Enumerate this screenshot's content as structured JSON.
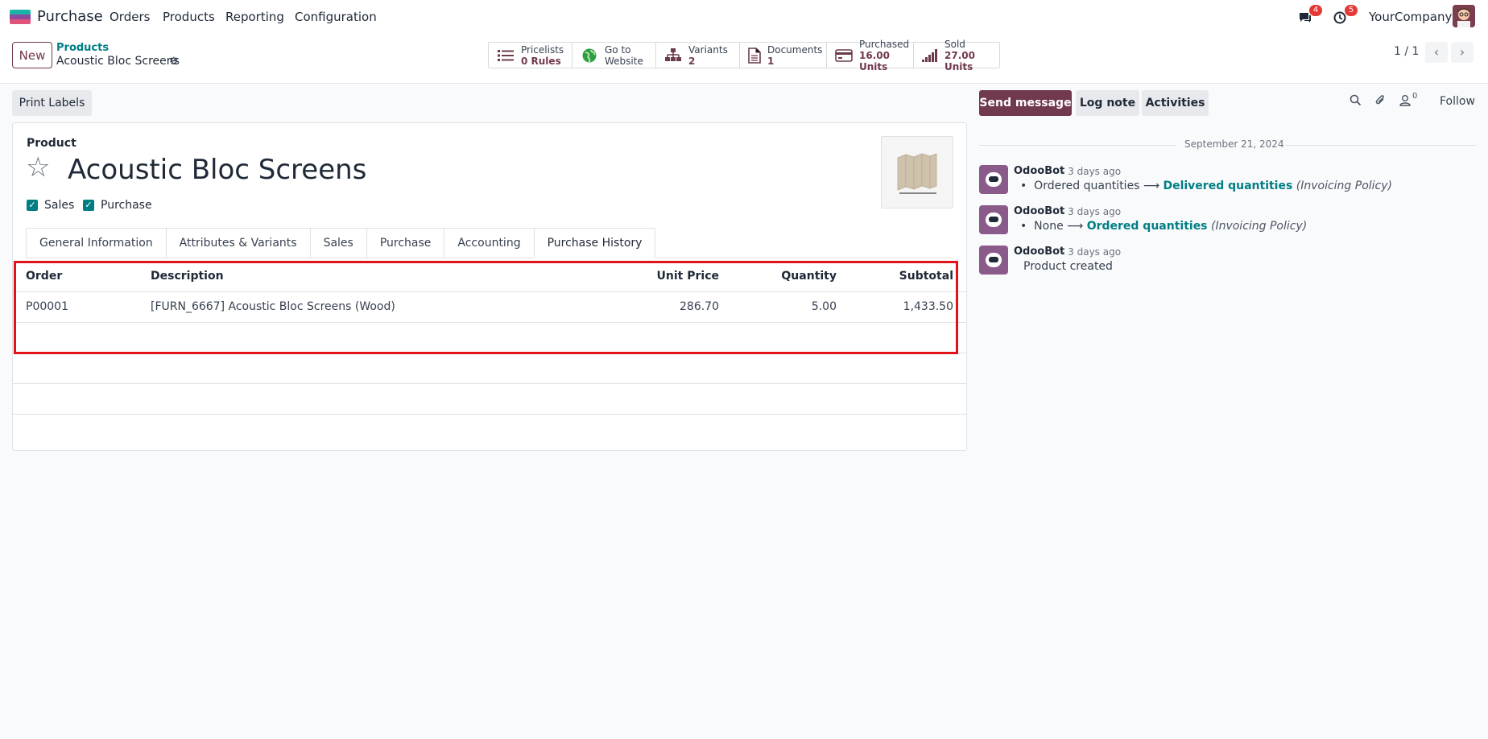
{
  "topbar": {
    "app_name": "Purchase",
    "menu": [
      "Orders",
      "Products",
      "Reporting",
      "Configuration"
    ],
    "chat_count": "4",
    "activity_count": "5",
    "company": "YourCompany"
  },
  "control": {
    "new_label": "New",
    "breadcrumb_parent": "Products",
    "breadcrumb_current": "Acoustic Bloc Screens",
    "smart_buttons": [
      {
        "l1": "Pricelists",
        "l2": "0 Rules",
        "icon": "list-icon"
      },
      {
        "l1": "Go to",
        "l2": "Website",
        "icon": "globe-icon"
      },
      {
        "l1": "Variants",
        "l2": "2",
        "icon": "sitemap-icon"
      },
      {
        "l1": "Documents",
        "l2": "1",
        "icon": "file-icon"
      },
      {
        "l1": "Purchased",
        "l2": "16.00 Units",
        "icon": "credit-card-icon"
      },
      {
        "l1": "Sold",
        "l2": "27.00 Units",
        "icon": "signal-icon"
      }
    ],
    "pager": "1 / 1"
  },
  "form": {
    "print_labels": "Print Labels",
    "product_label": "Product",
    "product_name": "Acoustic Bloc Screens",
    "sales_label": "Sales",
    "purchase_label": "Purchase",
    "tabs": [
      "General Information",
      "Attributes & Variants",
      "Sales",
      "Purchase",
      "Accounting",
      "Purchase History"
    ],
    "table": {
      "headers": [
        "Order",
        "Description",
        "Unit Price",
        "Quantity",
        "Subtotal"
      ],
      "rows": [
        [
          "P00001",
          "[FURN_6667] Acoustic Bloc Screens (Wood)",
          "286.70",
          "5.00",
          "1,433.50"
        ]
      ]
    }
  },
  "chatter": {
    "send_message": "Send message",
    "log_note": "Log note",
    "activities": "Activities",
    "followers_count": "0",
    "follow": "Follow",
    "date": "September 21, 2024",
    "messages": [
      {
        "author": "OdooBot",
        "when": "- 3 days ago",
        "old": "Ordered quantities",
        "new": "Delivered quantities",
        "field": "(Invoicing Policy)"
      },
      {
        "author": "OdooBot",
        "when": "- 3 days ago",
        "old": "None",
        "new": "Ordered quantities",
        "field": "(Invoicing Policy)"
      },
      {
        "author": "OdooBot",
        "when": "- 3 days ago",
        "text": "Product created"
      }
    ]
  }
}
